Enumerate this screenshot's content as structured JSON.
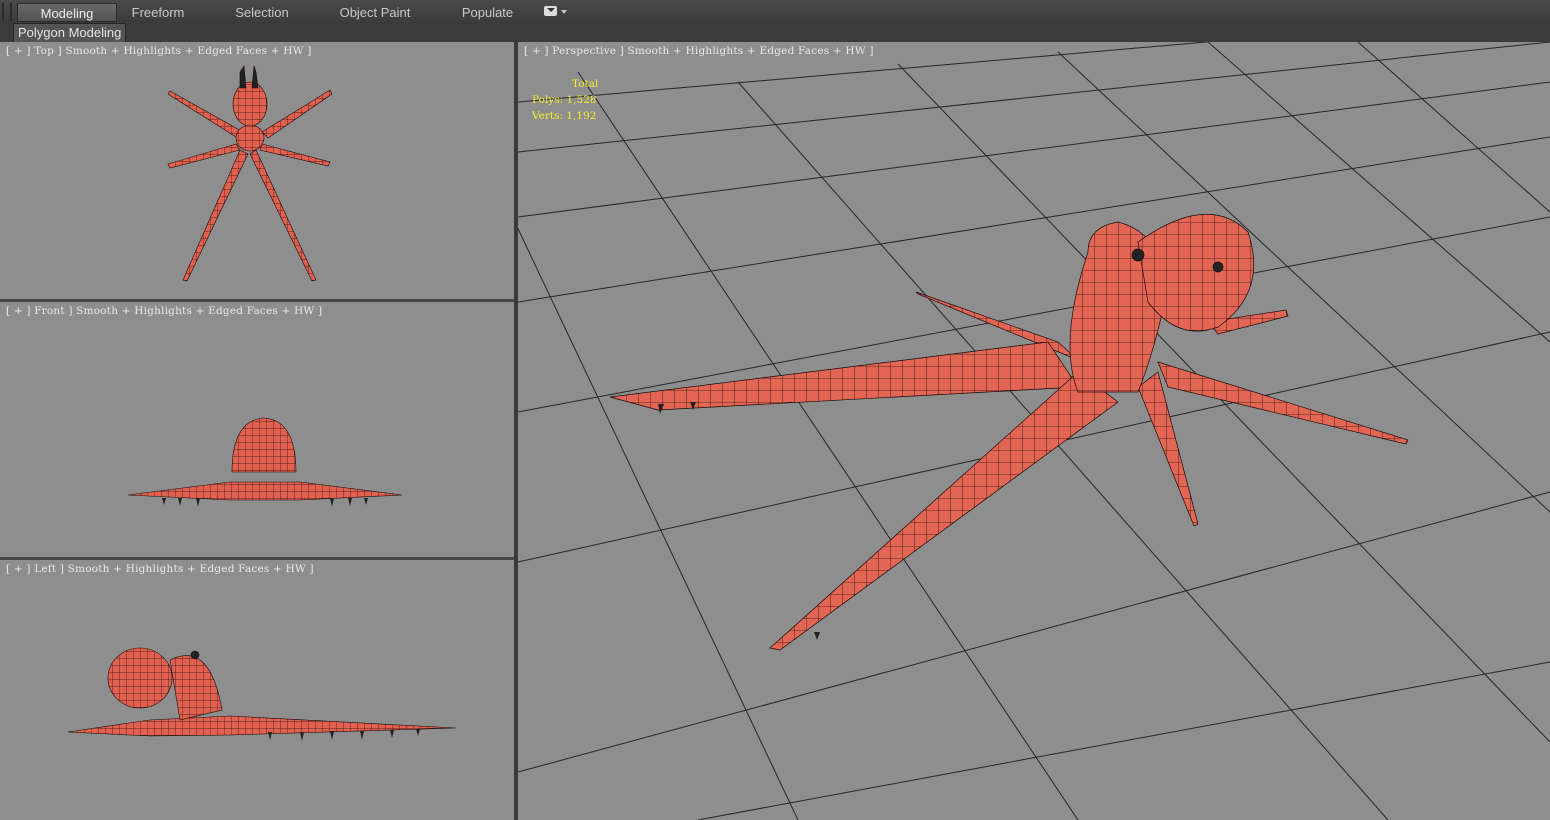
{
  "ribbon": {
    "tabs": [
      {
        "label": "Modeling",
        "active": true
      },
      {
        "label": "Freeform",
        "active": false
      },
      {
        "label": "Selection",
        "active": false
      },
      {
        "label": "Object Paint",
        "active": false
      },
      {
        "label": "Populate",
        "active": false
      }
    ],
    "sub_panel_label": "Polygon Modeling"
  },
  "viewports": {
    "top": {
      "label": "[ + ] Top ] Smooth + Highlights + Edged Faces + HW ]"
    },
    "front": {
      "label": "[ + ] Front ] Smooth + Highlights + Edged Faces + HW ]"
    },
    "left": {
      "label": "[ + ] Left ] Smooth + Highlights + Edged Faces + HW ]"
    },
    "perspective": {
      "label": "[ + ] Perspective ] Smooth + Highlights + Edged Faces + HW ]",
      "stats": {
        "total_label": "Total",
        "polys": "Polys: 1,528",
        "verts": "Verts: 1,192"
      }
    }
  },
  "colors": {
    "viewport_bg": "#8e8e8e",
    "mesh": "#e2604f",
    "grid": "#222222",
    "stats_text": "#f2ee2a"
  }
}
